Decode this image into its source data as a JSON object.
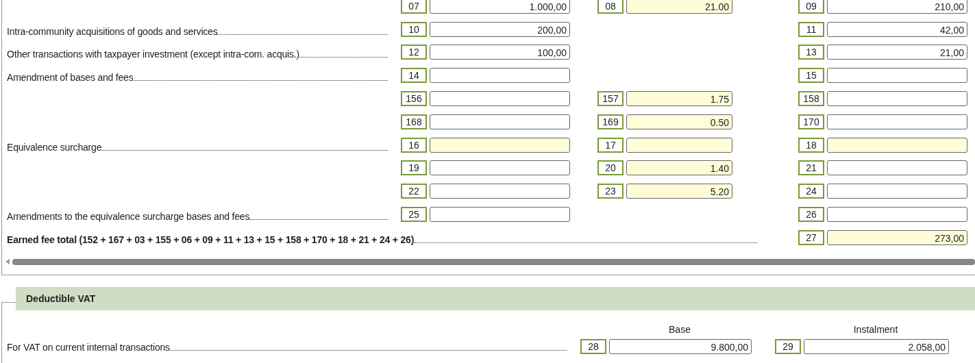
{
  "settled_vat": {
    "rows": [
      {
        "kind": "line",
        "cells": [
          {
            "code": "07",
            "value": "1.000,00",
            "highlighted": false
          },
          {
            "code": "08",
            "value": "21.00",
            "highlighted": true
          },
          {
            "code": "09",
            "value": "210,00",
            "highlighted": false
          }
        ]
      },
      {
        "kind": "line",
        "label": "Intra-community acquisitions of goods and services",
        "cells": [
          {
            "code": "10",
            "value": "200,00",
            "highlighted": false
          },
          null,
          {
            "code": "11",
            "value": "42,00",
            "highlighted": false
          }
        ]
      },
      {
        "kind": "line",
        "label": "Other transactions with taxpayer investment (except intra-com. acquis.)",
        "cells": [
          {
            "code": "12",
            "value": "100,00",
            "highlighted": false
          },
          null,
          {
            "code": "13",
            "value": "21,00",
            "highlighted": false
          }
        ]
      },
      {
        "kind": "line",
        "label": "Amendment of bases and fees",
        "cells": [
          {
            "code": "14",
            "highlighted": false
          },
          null,
          {
            "code": "15",
            "highlighted": false
          }
        ]
      },
      {
        "kind": "line",
        "cells": [
          {
            "code": "156",
            "highlighted": false
          },
          {
            "code": "157",
            "value": "1.75",
            "highlighted": true
          },
          {
            "code": "158",
            "highlighted": false
          }
        ]
      },
      {
        "kind": "line",
        "cells": [
          {
            "code": "168",
            "highlighted": false
          },
          {
            "code": "169",
            "value": "0.50",
            "highlighted": true
          },
          {
            "code": "170",
            "highlighted": false
          }
        ]
      },
      {
        "kind": "line",
        "label": "Equivalence surcharge",
        "cells": [
          {
            "code": "16",
            "highlighted": true
          },
          {
            "code": "17",
            "highlighted": true
          },
          {
            "code": "18",
            "highlighted": true
          }
        ]
      },
      {
        "kind": "line",
        "cells": [
          {
            "code": "19",
            "highlighted": false
          },
          {
            "code": "20",
            "value": "1.40",
            "highlighted": true
          },
          {
            "code": "21",
            "highlighted": false
          }
        ]
      },
      {
        "kind": "line",
        "cells": [
          {
            "code": "22",
            "highlighted": false
          },
          {
            "code": "23",
            "value": "5.20",
            "highlighted": true
          },
          {
            "code": "24",
            "highlighted": false
          }
        ]
      },
      {
        "kind": "line",
        "label": "Amendments to the equivalence surcharge bases and fees",
        "cells": [
          {
            "code": "25",
            "highlighted": false
          },
          null,
          {
            "code": "26",
            "highlighted": false
          }
        ]
      },
      {
        "kind": "total",
        "label": "Earned fee total (152 + 167 + 03 + 155 + 06 + 09 + 11 + 13 + 15 + 158 + 170 + 18 + 21 + 24 + 26)",
        "cells": [
          null,
          null,
          {
            "code": "27",
            "value": "273,00",
            "highlighted": true
          }
        ]
      }
    ]
  },
  "deductible_vat": {
    "title": "Deductible VAT",
    "column_headers": [
      "Base",
      "Instalment"
    ],
    "rows": [
      {
        "label": "For VAT on current internal transactions",
        "cells": [
          {
            "code": "28",
            "value": "9.800,00",
            "highlighted": false
          },
          {
            "code": "29",
            "value": "2.058,00",
            "highlighted": false
          }
        ]
      }
    ]
  }
}
